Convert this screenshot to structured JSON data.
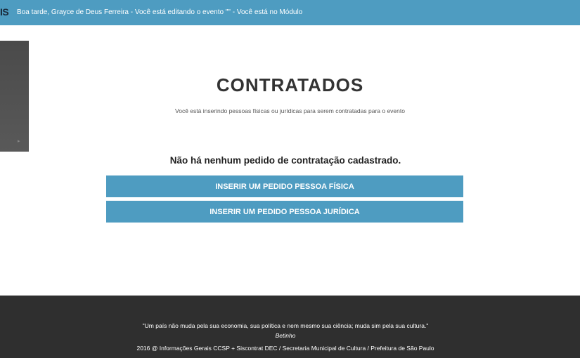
{
  "header": {
    "brand": "IS",
    "greeting": "Boa tarde, Grayce de Deus Ferreira - Você está editando o evento \"\" - Você está no Módulo"
  },
  "side_panel": {
    "arrow_icon": "chevron-right-icon"
  },
  "main": {
    "title": "CONTRATADOS",
    "subtitle": "Você está inserindo pessoas físicas ou jurídicas para serem contratadas para o evento",
    "notice": "Não há nenhum pedido de contratação cadastrado.",
    "buttons": {
      "pessoa_fisica": "INSERIR UM PEDIDO PESSOA FÍSICA",
      "pessoa_juridica": "INSERIR UM PEDIDO PESSOA JURÍDICA"
    }
  },
  "footer": {
    "quote": "\"Um país não muda pela sua economia, sua política e nem mesmo sua ciência; muda sim pela sua cultura.\"",
    "author": "Betinho",
    "credits": "2016 @ Informações Gerais CCSP + Siscontrat DEC / Secretaria Municipal de Cultura / Prefeitura de São Paulo"
  },
  "colors": {
    "accent": "#4e9cc1",
    "footer_bg": "#2f2f2f",
    "side_panel_bg": "#505050"
  }
}
